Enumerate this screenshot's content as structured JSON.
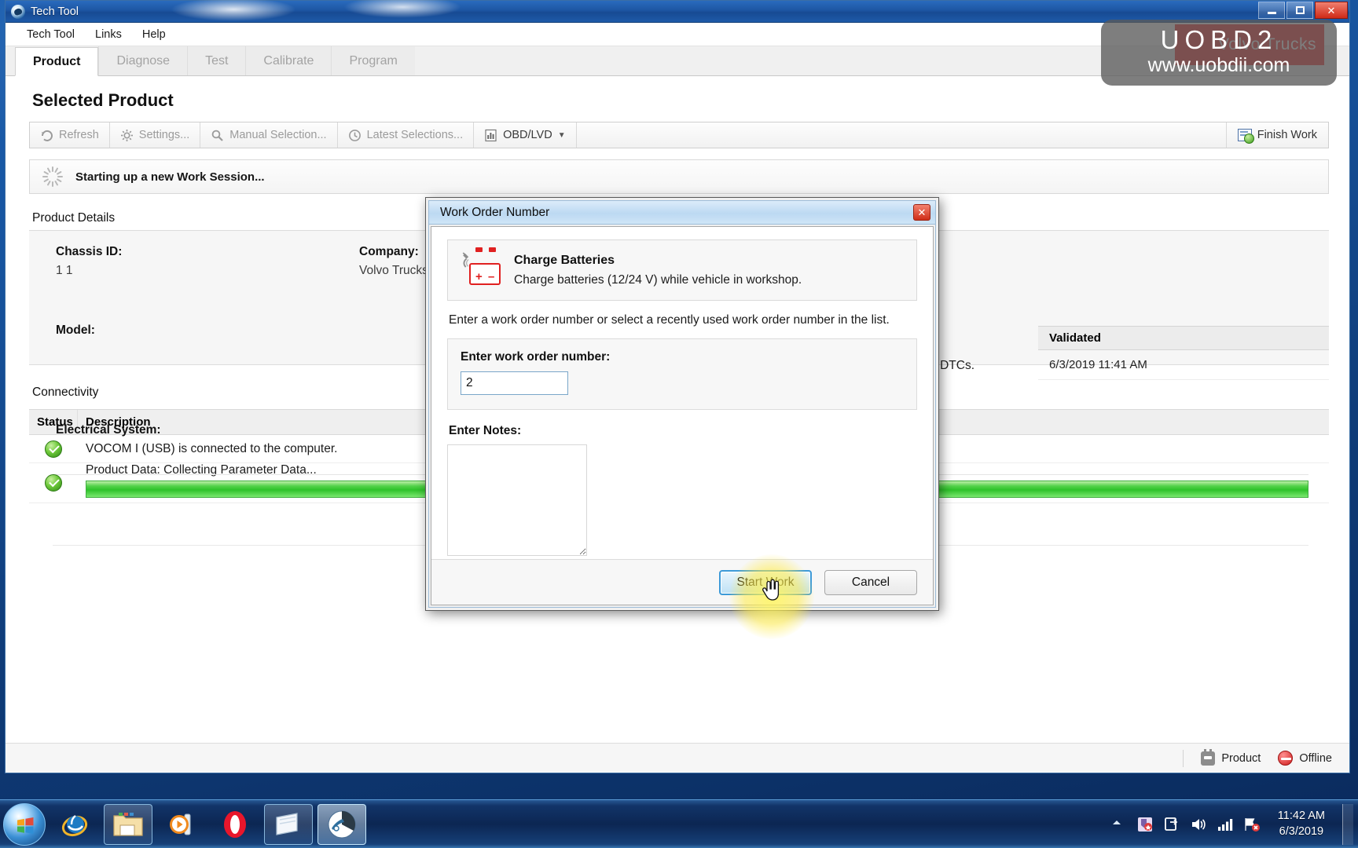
{
  "window": {
    "title": "Tech Tool",
    "icon": "tech-tool-icon",
    "controls": {
      "minimize": "–",
      "maximize": "❐",
      "close": "✕"
    }
  },
  "menubar": {
    "items": [
      "Tech Tool",
      "Links",
      "Help"
    ]
  },
  "tabs": [
    {
      "label": "Product",
      "active": true
    },
    {
      "label": "Diagnose",
      "active": false
    },
    {
      "label": "Test",
      "active": false
    },
    {
      "label": "Calibrate",
      "active": false
    },
    {
      "label": "Program",
      "active": false
    }
  ],
  "page": {
    "title": "Selected Product",
    "toolbar": {
      "buttons": [
        {
          "label": "Refresh",
          "icon": "refresh-icon",
          "enabled": false
        },
        {
          "label": "Settings...",
          "icon": "gear-icon",
          "enabled": false
        },
        {
          "label": "Manual Selection...",
          "icon": "search-icon",
          "enabled": false
        },
        {
          "label": "Latest Selections...",
          "icon": "clock-icon",
          "enabled": false
        },
        {
          "label": "OBD/LVD",
          "icon": "chart-icon",
          "enabled": true,
          "dropdown": "▼"
        }
      ],
      "finish_work": {
        "label": "Finish Work",
        "icon": "finish-work-icon"
      }
    },
    "session_status": "Starting up a new Work Session...",
    "product_details": {
      "heading": "Product Details",
      "fields": [
        {
          "label": "Chassis ID:",
          "value": "1 1"
        },
        {
          "label": "Company:",
          "value": "Volvo Trucks"
        },
        {
          "label": "Model:",
          "value": ""
        },
        {
          "label": "Electrical System:",
          "value": ""
        }
      ]
    },
    "validated_table": {
      "header": "Validated",
      "rows": [
        {
          "note": "gnose to view DTCs.",
          "validated": "6/3/2019 11:41 AM"
        }
      ]
    },
    "connectivity": {
      "heading": "Connectivity",
      "columns": [
        "Status",
        "Description"
      ],
      "rows": [
        {
          "status": "ok",
          "description": "VOCOM I (USB) is connected to the computer.",
          "progress": null
        },
        {
          "status": "ok",
          "description": "Product Data: Collecting Parameter Data...",
          "progress": 100
        }
      ]
    }
  },
  "statusbar": {
    "items": [
      {
        "label": "Product",
        "icon": "product-plug-icon"
      },
      {
        "label": "Offline",
        "icon": "offline-icon"
      }
    ]
  },
  "dialog": {
    "title": "Work Order Number",
    "close": "✕",
    "notice": {
      "icon": "charge-battery-icon",
      "heading": "Charge Batteries",
      "body": "Charge batteries (12/24 V) while vehicle in workshop."
    },
    "instruction": "Enter a work order number or select a recently used work order number in the list.",
    "work_order": {
      "label": "Enter work order number:",
      "value": "2",
      "placeholder": ""
    },
    "notes": {
      "label": "Enter Notes:",
      "value": "",
      "placeholder": ""
    },
    "buttons": {
      "primary": "Start Work",
      "secondary": "Cancel"
    }
  },
  "watermark": {
    "brand": "Volvo Trucks",
    "line1": "UOBD2",
    "line2": "www.uobdii.com"
  },
  "taskbar": {
    "start": "start-orb",
    "items": [
      {
        "name": "internet-explorer-icon",
        "pinned": true,
        "boxed": false
      },
      {
        "name": "windows-explorer-icon",
        "pinned": true,
        "boxed": true
      },
      {
        "name": "windows-media-player-icon",
        "pinned": true,
        "boxed": false
      },
      {
        "name": "opera-icon",
        "pinned": true,
        "boxed": false
      },
      {
        "name": "sticky-notes-icon",
        "pinned": true,
        "boxed": true
      },
      {
        "name": "tech-tool-icon",
        "pinned": true,
        "boxed": true,
        "active": true
      }
    ],
    "tray": [
      {
        "name": "show-hidden-icons-arrow"
      },
      {
        "name": "security-shield-icon"
      },
      {
        "name": "network-plug-icon"
      },
      {
        "name": "volume-icon"
      },
      {
        "name": "signal-bars-icon"
      },
      {
        "name": "network-error-flag-icon"
      }
    ],
    "clock": {
      "time": "11:42 AM",
      "date": "6/3/2019"
    }
  },
  "colors": {
    "accent_blue": "#1d56a3",
    "dialog_title": "#bcd9f2",
    "progress_green": "#2ec22a",
    "brand_red": "#ef2b2b",
    "watermark_gray": "#5a5a5a"
  }
}
